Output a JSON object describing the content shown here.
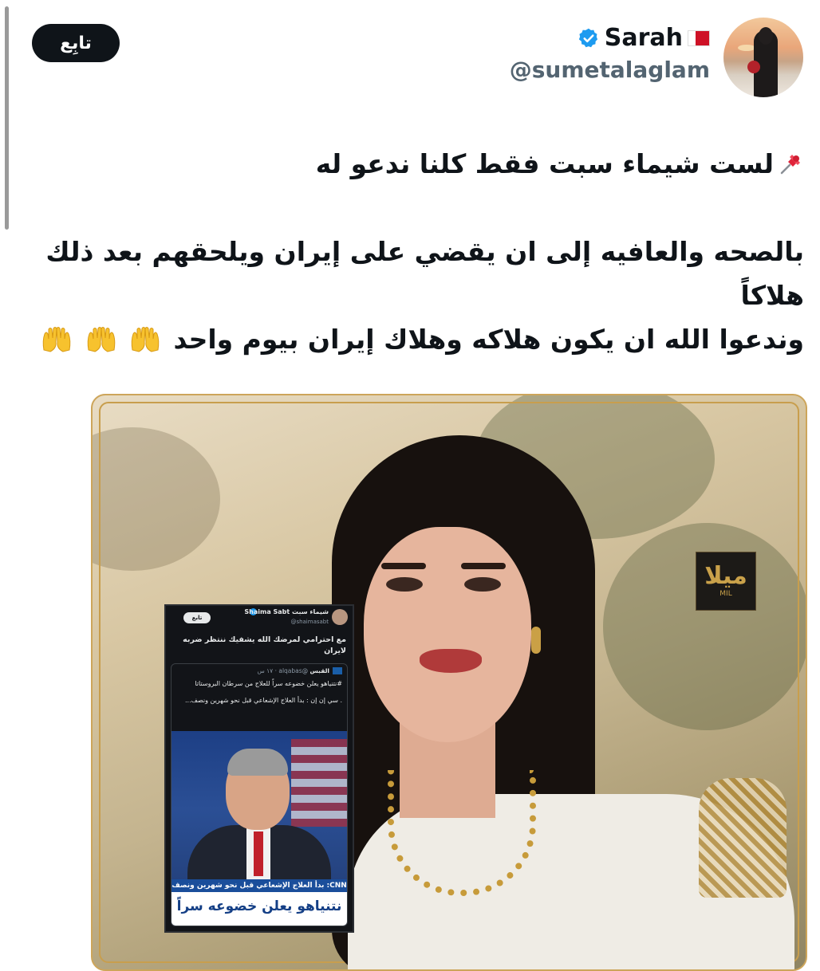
{
  "user": {
    "display_name": "Sarah",
    "handle": "@sumetalaglam",
    "flag_icon": "bahrain-flag-icon",
    "verified_icon": "verified-badge-icon"
  },
  "follow_label": "تابِع",
  "tweet": {
    "line1": "لست شيماء سبت فقط كلنا ندعو له",
    "line2": "بالصحه والعافيه إلى ان يقضي على إيران ويلحقهم بعد ذلك",
    "line3": "هلاكاً",
    "line4": "وندعوا الله ان يكون هلاكه وهلاك إيران بيوم واحد",
    "pin_icon": "pushpin-icon",
    "hands_icon": "raising-hands-icon"
  },
  "media": {
    "logo_text": "ميلا",
    "logo_sub": "MIL",
    "inset": {
      "follow_label": "تابع",
      "name": "Shaima Sabt شيماء سبت",
      "handle": "@shaimasabt",
      "text": "مع احترامي لمرضك الله يشفيك ننتظر ضربه لايران",
      "quote_name": "القبس",
      "quote_meta": "@alqabas · ١٧ س",
      "quote_line1": "#نتنياهو يعلن خضوعه سراً للعلاج من سرطان البروستاتا",
      "quote_line2": ". سي إن إن : بدأ العلاج الإشعاعي قبل نحو شهرين ونصف...",
      "caption_top": "CNN: بدأ العلاج الإشعاعي قبل نحو شهرين ونصف",
      "caption_main": "نتنياهو يعلن خضوعه سراً"
    }
  },
  "colors": {
    "text": "#0f1419",
    "secondary": "#536471",
    "verified": "#1d9bf0",
    "frame_gold": "#c89e4d"
  }
}
